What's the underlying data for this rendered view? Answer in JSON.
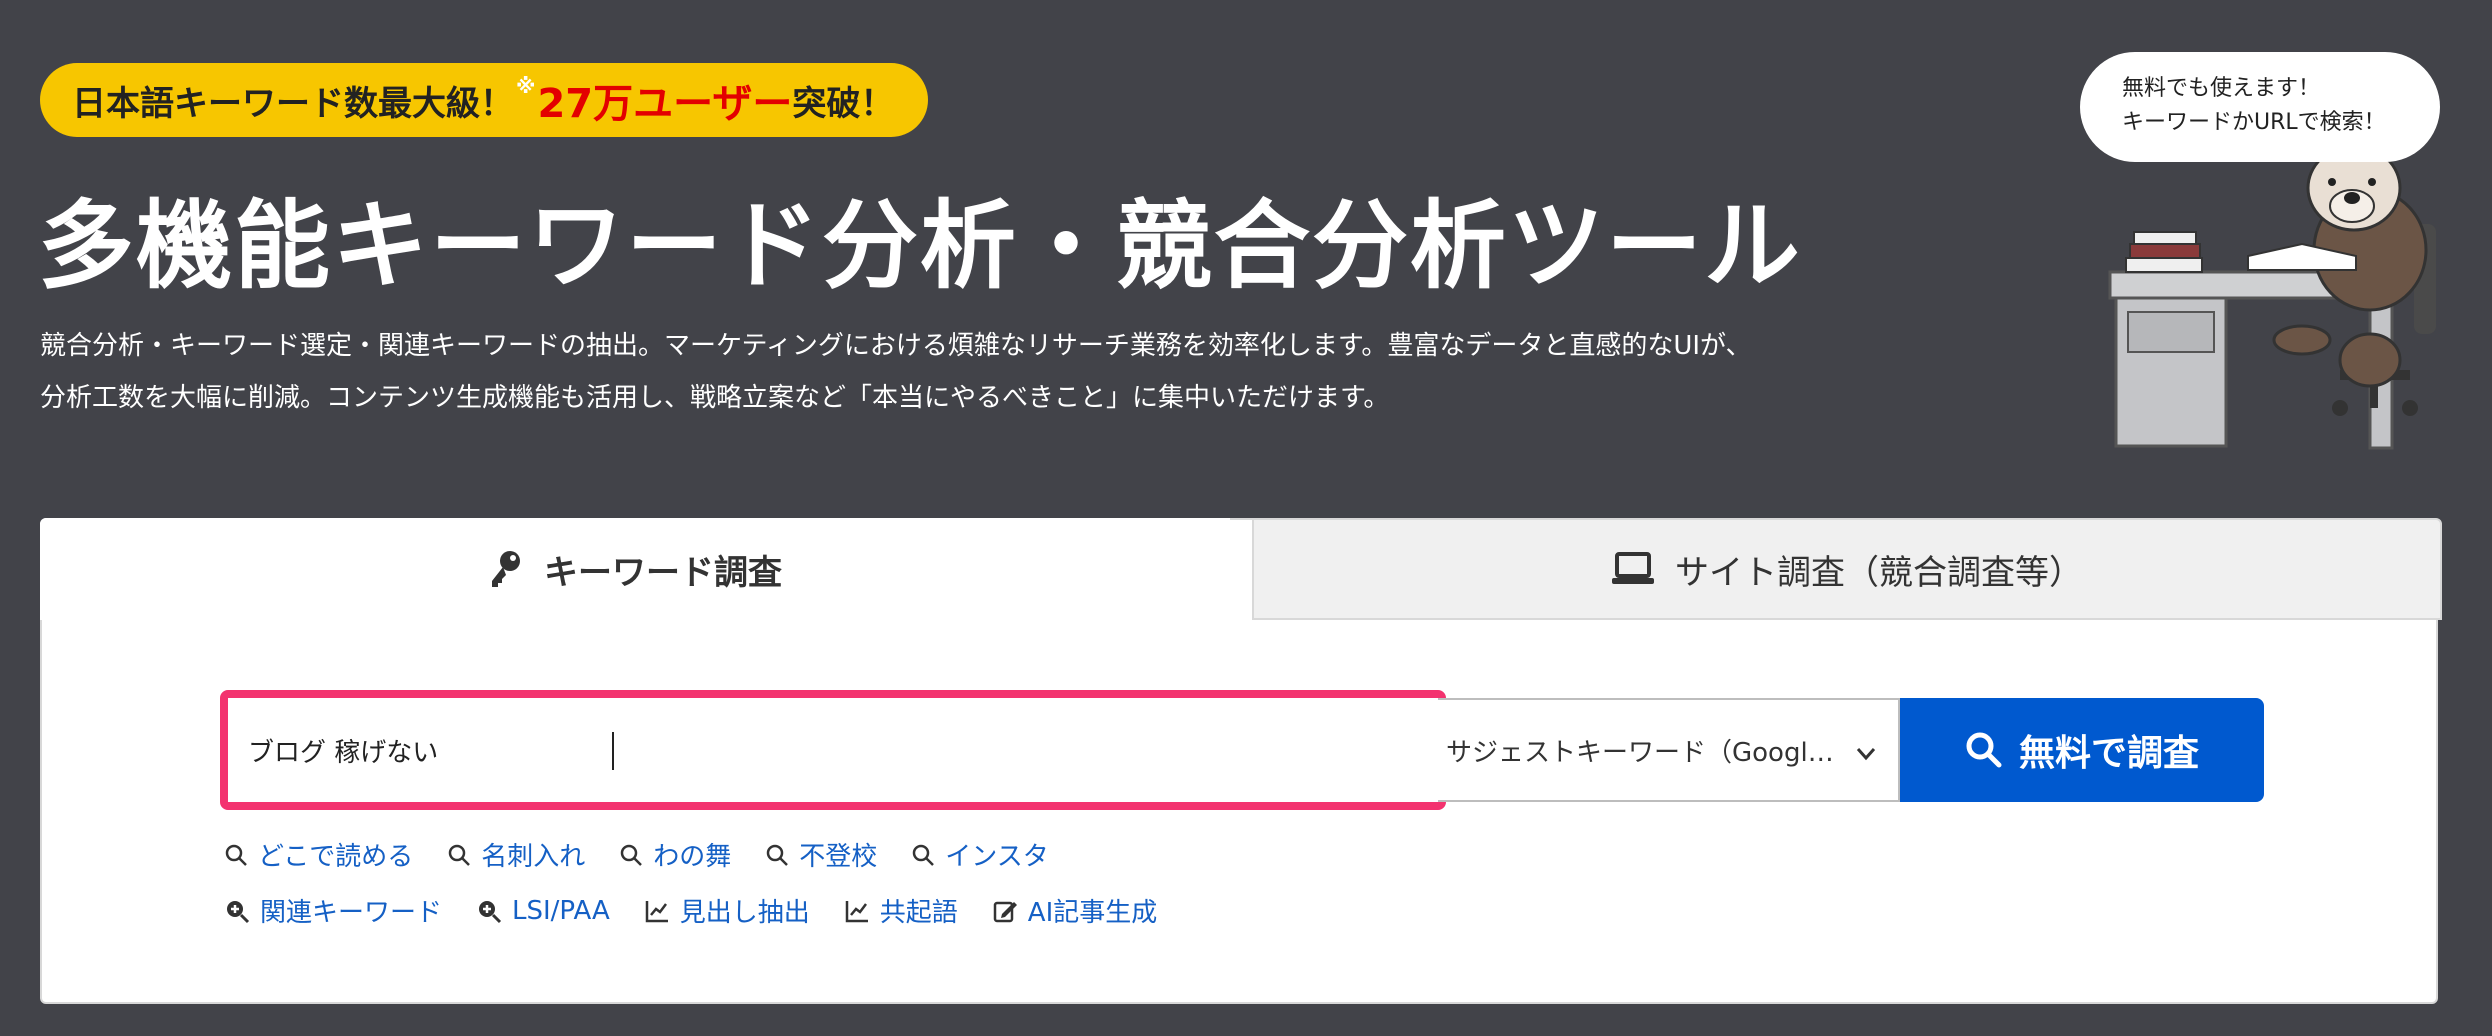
{
  "hero": {
    "badge": {
      "prefix": "日本語キーワード数最大級！",
      "asterisk": "※",
      "highlight": "27万ユーザー",
      "suffix": "突破！"
    },
    "title": "多機能キーワード分析・競合分析ツール",
    "description_line1": "競合分析・キーワード選定・関連キーワードの抽出。マーケティングにおける煩雑なリサーチ業務を効率化します。豊富なデータと直感的なUIが、",
    "description_line2": "分析工数を大幅に削減。コンテンツ生成機能も活用し、戦略立案など「本当にやるべきこと」に集中いただけます。"
  },
  "mascot": {
    "bubble_line1": "無料でも使えます！",
    "bubble_line2": "キーワードかURLで検索！"
  },
  "tabs": [
    {
      "label": "キーワード調査",
      "icon": "key-icon",
      "active": true
    },
    {
      "label": "サイト調査（競合調査等）",
      "icon": "laptop-icon",
      "active": false
    }
  ],
  "search": {
    "value": "ブログ 稼げない",
    "select_value": "サジェストキーワード（Googl…",
    "submit_label": "無料で調査"
  },
  "suggestions": [
    "どこで読める",
    "名刺入れ",
    "わの舞",
    "不登校",
    "インスタ"
  ],
  "tools": [
    {
      "label": "関連キーワード",
      "icon": "zoom-plus-icon"
    },
    {
      "label": "LSI/PAA",
      "icon": "zoom-plus-icon"
    },
    {
      "label": "見出し抽出",
      "icon": "line-chart-icon"
    },
    {
      "label": "共起語",
      "icon": "line-chart-icon"
    },
    {
      "label": "AI記事生成",
      "icon": "edit-icon"
    }
  ],
  "colors": {
    "background": "#424349",
    "badge": "#f7c600",
    "highlight": "#e30000",
    "input_border": "#f3336f",
    "primary": "#0059cf",
    "link": "#1560c5"
  }
}
